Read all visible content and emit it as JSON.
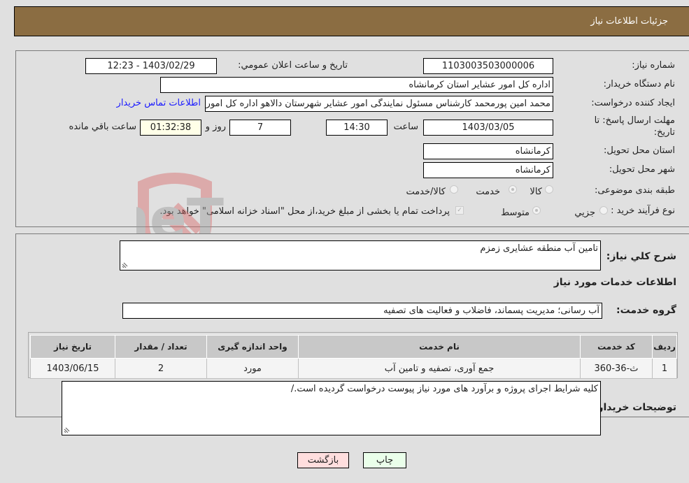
{
  "header": {
    "title": "جزئيات اطلاعات نياز"
  },
  "details": {
    "need_number_label": "شماره نياز:",
    "need_number": "1103003503000006",
    "announce_label": "تاريخ و ساعت اعلان عمومي:",
    "announce_value": "1403/02/29 - 12:23",
    "buyer_org_label": "نام دستگاه خريدار:",
    "buyer_org": "اداره کل امور عشایر استان کرمانشاه",
    "creator_label": "ايجاد کننده درخواست:",
    "creator": "محمد امین پورمحمد کارشناس مسئول نمایندگی امور عشایر شهرستان دالاهو اداره کل امور عشایر استان کرمانشاه",
    "contact_link": "اطلاعات تماس خريدار",
    "deadline_label": "مهلت ارسال پاسخ: تا تاريخ:",
    "deadline_date": "1403/03/05",
    "time_label": "ساعت",
    "deadline_time": "14:30",
    "days": "7",
    "days_label": "روز و",
    "remaining": "01:32:38",
    "remaining_label": "ساعت باقي مانده",
    "province_label": "استان محل تحويل:",
    "province": "کرمانشاه",
    "city_label": "شهر محل تحويل:",
    "city": "کرمانشاه",
    "category_label": "طبقه بندی موضوعی:",
    "category_options": [
      "کالا",
      "خدمت",
      "کالا/خدمت"
    ],
    "category_selected": "خدمت",
    "process_label": "نوع فرآيند خريد :",
    "process_options": [
      "جزيي",
      "متوسط"
    ],
    "process_selected": "متوسط",
    "treasury_note": "پرداخت تمام یا بخشی از مبلغ خرید،از محل \"اسناد خزانه اسلامی\" خواهد بود.",
    "treasury_checked": true
  },
  "watermark": {
    "text": "AriaTender.neT"
  },
  "services": {
    "description_label": "شرح كلي نياز:",
    "description": "تامین آب منطقه عشایری زمزم",
    "section_title": "اطلاعات خدمات مورد نياز",
    "group_label": "گروه خدمت:",
    "group_value": "آب رسانی؛ مدیریت پسماند، فاضلاب و فعالیت های تصفیه",
    "table": {
      "headers": [
        "رديف",
        "کد خدمت",
        "نام خدمت",
        "واحد اندازه گيری",
        "تعداد / مقدار",
        "تاريخ نياز"
      ],
      "rows": [
        [
          "1",
          "ث-36-360",
          "جمع آوری، تصفیه و تامین آب",
          "مورد",
          "2",
          "1403/06/15"
        ]
      ]
    },
    "buyer_notes_label": "توضيحات خريدار:",
    "buyer_notes": "کلیه شرایط اجرای پروژه و برآورد های مورد نیاز پیوست درخواست گردیده است./"
  },
  "buttons": {
    "print": "چاپ",
    "back": "بازگشت"
  },
  "colors": {
    "header_bg": "#8b6d42",
    "print_bg": "#eaffea",
    "back_bg": "#ffdede",
    "link": "#1a1aff"
  }
}
